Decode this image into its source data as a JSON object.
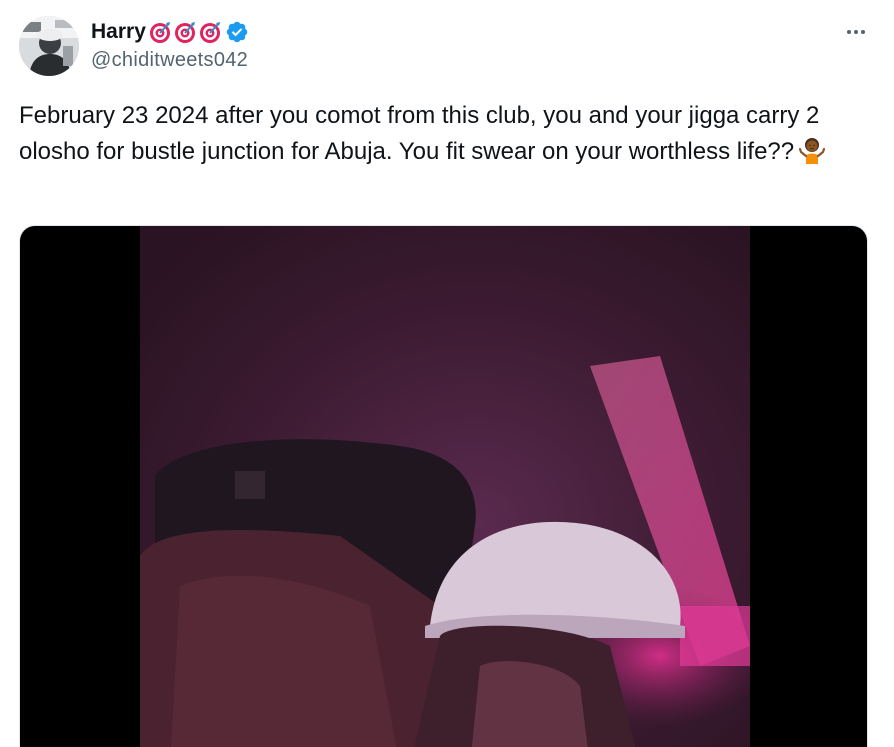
{
  "author": {
    "display_name": "Harry",
    "name_emojis": [
      "target-emoji",
      "target-emoji",
      "target-emoji"
    ],
    "verified": true,
    "handle": "@chiditweets042",
    "avatar_icon": "person-avatar"
  },
  "more_menu_icon": "more-horizontal-icon",
  "tweet": {
    "text": "February 23 2024 after you comot from this club, you and your jigga carry 2 olosho for bustle junction for Abuja. You fit swear on your worthless life??",
    "trailing_emoji": "person-shrugging-emoji"
  },
  "media": {
    "type": "video",
    "background": "#000000"
  },
  "colors": {
    "text_primary": "#0f1419",
    "text_secondary": "#536471",
    "verified_blue": "#1d9bf0",
    "target_red": "#e0245e"
  }
}
